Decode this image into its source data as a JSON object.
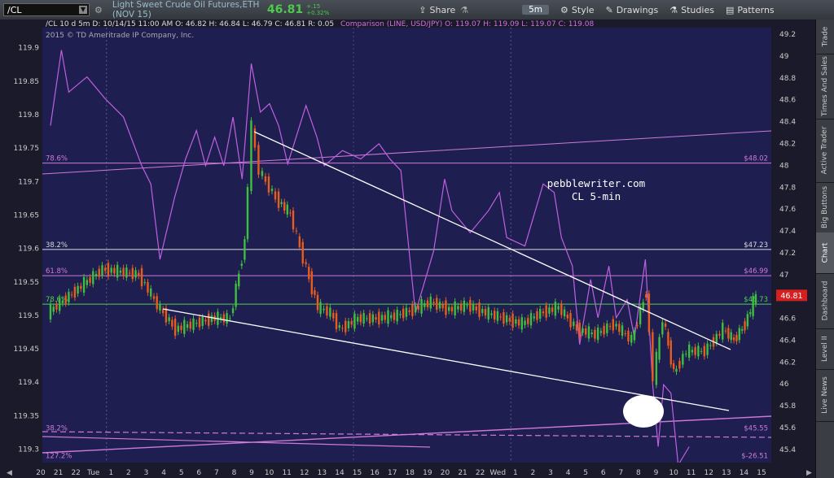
{
  "toolbar": {
    "symbol": "/CL",
    "description": "Light Sweet Crude Oil Futures,ETH (NOV 15)",
    "last_price": "46.81",
    "change": "+.15",
    "change_pct": "+0.32%",
    "share_label": "Share",
    "interval": "5m",
    "style_label": "Style",
    "drawings_label": "Drawings",
    "studies_label": "Studies",
    "patterns_label": "Patterns"
  },
  "sidebar_tabs": [
    "Trade",
    "Times And Sales",
    "Active Trader",
    "Big Buttons",
    "Chart",
    "Dashboard",
    "Level II",
    "Live News"
  ],
  "chart_header": {
    "line1": "/CL 10 d 5m   D: 10/14/15 11:00 AM   O: 46.82   H: 46.84   L: 46.79   C: 46.81   R: 0.05",
    "comparison": "Comparison (LINE, USD/JPY)   O: 119.07   H: 119.09   L: 119.07   C: 119.08",
    "copyright": "2015 © TD Ameritrade IP Company, Inc."
  },
  "watermark": {
    "line1": "pebblewriter.com",
    "line2": "CL 5-min"
  },
  "colors": {
    "background": "#1e1e50",
    "candle_up": "#3fbf3f",
    "candle_down": "#e85c1c",
    "comparison": "#c060e0",
    "trend": "#ffffff",
    "fib_purple": "#d07ad8",
    "fib_green": "#4fd14f"
  },
  "chart_data": {
    "type": "line",
    "left_axis": {
      "ticks": [
        "119.9",
        "119.85",
        "119.8",
        "119.75",
        "119.7",
        "119.65",
        "119.6",
        "119.55",
        "119.5",
        "119.45",
        "119.4",
        "119.35",
        "119.3"
      ],
      "range": [
        119.28,
        119.93
      ]
    },
    "right_axis": {
      "ticks": [
        "49.2",
        "49",
        "48.8",
        "48.6",
        "48.4",
        "48.2",
        "48",
        "47.8",
        "47.6",
        "47.4",
        "47.2",
        "47",
        "46.8",
        "46.6",
        "46.4",
        "46.2",
        "46",
        "45.8",
        "45.6",
        "45.4"
      ],
      "range": [
        45.28,
        49.26
      ]
    },
    "x_ticks": [
      "20",
      "21",
      "22",
      "Tue",
      "1",
      "2",
      "3",
      "4",
      "5",
      "6",
      "7",
      "8",
      "9",
      "10",
      "11",
      "12",
      "13",
      "14",
      "15",
      "16",
      "17",
      "18",
      "19",
      "20",
      "21",
      "22",
      "Wed",
      "1",
      "2",
      "3",
      "4",
      "5",
      "6",
      "7",
      "8",
      "9",
      "10",
      "11",
      "12",
      "13",
      "14",
      "15"
    ],
    "fib_levels_left": [
      {
        "label": "78.6%",
        "price": "$48.02",
        "value": 48.02,
        "color": "purple"
      },
      {
        "label": "38.2%",
        "price": "$47.23",
        "value": 47.23,
        "color": "white"
      },
      {
        "label": "61.8%",
        "price": "$46.99",
        "value": 46.99,
        "color": "purple"
      },
      {
        "label": "78.6%",
        "price": "$46.73",
        "value": 46.73,
        "color": "green"
      },
      {
        "label": "38.2%",
        "price": "$45.55",
        "value": 45.55,
        "color": "purple"
      },
      {
        "label": "127.2%",
        "price": "$-26.51",
        "value": 45.3,
        "color": "purple"
      }
    ],
    "current_price": "46.81",
    "crude_path": [
      [
        0,
        46.65
      ],
      [
        3,
        47.05
      ],
      [
        5,
        47.0
      ],
      [
        6,
        46.72
      ],
      [
        7,
        46.5
      ],
      [
        8,
        46.55
      ],
      [
        9,
        46.6
      ],
      [
        10,
        46.6
      ],
      [
        10.8,
        47.3
      ],
      [
        11.2,
        48.35
      ],
      [
        11.6,
        47.95
      ],
      [
        12.5,
        47.7
      ],
      [
        13.3,
        47.55
      ],
      [
        14.0,
        47.15
      ],
      [
        14.8,
        46.7
      ],
      [
        15.5,
        46.65
      ],
      [
        16,
        46.5
      ],
      [
        17,
        46.6
      ],
      [
        18,
        46.6
      ],
      [
        19,
        46.62
      ],
      [
        20,
        46.68
      ],
      [
        21,
        46.75
      ],
      [
        22,
        46.68
      ],
      [
        23,
        46.72
      ],
      [
        24,
        46.65
      ],
      [
        25,
        46.6
      ],
      [
        26,
        46.55
      ],
      [
        27,
        46.65
      ],
      [
        28,
        46.7
      ],
      [
        29,
        46.5
      ],
      [
        30,
        46.45
      ],
      [
        31,
        46.55
      ],
      [
        32,
        46.4
      ],
      [
        32.8,
        46.85
      ],
      [
        33.2,
        46.05
      ],
      [
        33.7,
        46.6
      ],
      [
        34.3,
        46.1
      ],
      [
        35,
        46.3
      ],
      [
        36,
        46.3
      ],
      [
        37,
        46.5
      ],
      [
        37.6,
        46.4
      ],
      [
        38.2,
        46.55
      ],
      [
        38.8,
        46.81
      ]
    ],
    "comparison_path": [
      [
        0,
        119.78
      ],
      [
        0.6,
        119.9
      ],
      [
        1,
        119.83
      ],
      [
        2,
        119.86
      ],
      [
        3,
        119.82
      ],
      [
        4,
        119.8
      ],
      [
        5,
        119.72
      ],
      [
        5.5,
        119.7
      ],
      [
        6,
        119.58
      ],
      [
        6.8,
        119.68
      ],
      [
        7.4,
        119.73
      ],
      [
        8,
        119.78
      ],
      [
        8.5,
        119.72
      ],
      [
        9,
        119.77
      ],
      [
        9.5,
        119.72
      ],
      [
        10,
        119.8
      ],
      [
        10.5,
        119.7
      ],
      [
        11,
        119.88
      ],
      [
        11.5,
        119.8
      ],
      [
        12,
        119.82
      ],
      [
        12.5,
        119.78
      ],
      [
        13,
        119.73
      ],
      [
        14,
        119.81
      ],
      [
        14.6,
        119.77
      ],
      [
        15,
        119.72
      ],
      [
        16,
        119.75
      ],
      [
        17,
        119.73
      ],
      [
        18,
        119.76
      ],
      [
        18.6,
        119.73
      ],
      [
        19.2,
        119.72
      ],
      [
        20,
        119.5
      ],
      [
        21,
        119.6
      ],
      [
        21.6,
        119.7
      ],
      [
        22,
        119.66
      ],
      [
        23,
        119.62
      ],
      [
        24,
        119.66
      ],
      [
        24.6,
        119.68
      ],
      [
        25,
        119.62
      ],
      [
        26,
        119.6
      ],
      [
        27,
        119.7
      ],
      [
        27.6,
        119.68
      ],
      [
        28,
        119.62
      ],
      [
        28.6,
        119.57
      ],
      [
        29,
        119.46
      ],
      [
        29.6,
        119.55
      ],
      [
        30,
        119.5
      ],
      [
        30.6,
        119.57
      ],
      [
        31,
        119.5
      ],
      [
        31.6,
        119.52
      ],
      [
        32,
        119.47
      ],
      [
        32.6,
        119.58
      ],
      [
        33,
        119.4
      ],
      [
        33.3,
        119.3
      ],
      [
        33.6,
        119.4
      ],
      [
        34,
        119.38
      ],
      [
        34.4,
        119.28
      ],
      [
        35,
        119.3
      ]
    ]
  }
}
